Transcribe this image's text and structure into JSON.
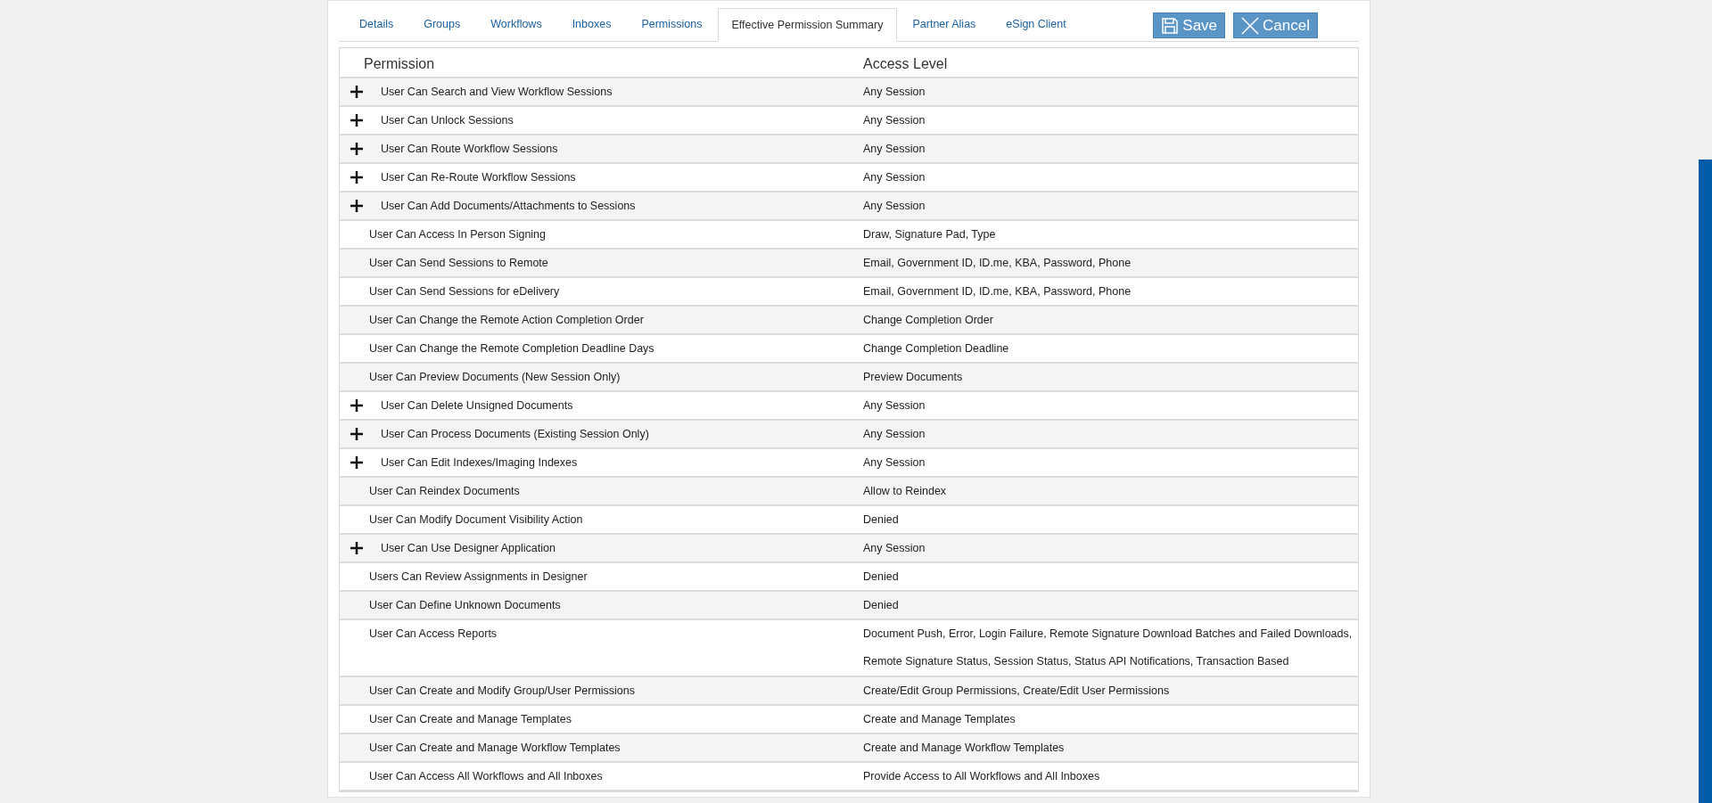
{
  "tabs": [
    {
      "label": "Details",
      "selected": false
    },
    {
      "label": "Groups",
      "selected": false
    },
    {
      "label": "Workflows",
      "selected": false
    },
    {
      "label": "Inboxes",
      "selected": false
    },
    {
      "label": "Permissions",
      "selected": false
    },
    {
      "label": "Effective Permission Summary",
      "selected": true
    },
    {
      "label": "Partner Alias",
      "selected": false
    },
    {
      "label": "eSign Client",
      "selected": false
    }
  ],
  "buttons": [
    {
      "kind": "save",
      "label": "Save"
    },
    {
      "kind": "cancel",
      "label": "Cancel"
    }
  ],
  "table": {
    "columns": [
      "Permission",
      "Access Level"
    ],
    "rows": [
      {
        "kind": "expandable",
        "expanded": false,
        "permission": "User Can Search and View Workflow Sessions",
        "access": [
          "Any Session"
        ]
      },
      {
        "kind": "expandable",
        "expanded": false,
        "permission": "User Can Unlock Sessions",
        "access": [
          "Any Session"
        ]
      },
      {
        "kind": "expandable",
        "expanded": false,
        "permission": "User Can Route Workflow Sessions",
        "access": [
          "Any Session"
        ]
      },
      {
        "kind": "expandable",
        "expanded": false,
        "permission": "User Can Re-Route Workflow Sessions",
        "access": [
          "Any Session"
        ]
      },
      {
        "kind": "expandable",
        "expanded": false,
        "permission": "User Can Add Documents/Attachments to Sessions",
        "access": [
          "Any Session"
        ]
      },
      {
        "kind": "plain",
        "permission": "User Can Access In Person Signing",
        "access": [
          "Draw, Signature Pad, Type"
        ]
      },
      {
        "kind": "plain",
        "permission": "User Can Send Sessions to Remote",
        "access": [
          "Email, Government ID, ID.me, KBA, Password, Phone"
        ]
      },
      {
        "kind": "plain",
        "permission": "User Can Send Sessions for eDelivery",
        "access": [
          "Email, Government ID, ID.me, KBA, Password, Phone"
        ]
      },
      {
        "kind": "plain",
        "permission": "User Can Change the Remote Action Completion Order",
        "access": [
          "Change Completion Order"
        ]
      },
      {
        "kind": "plain",
        "permission": "User Can Change the Remote Completion Deadline Days",
        "access": [
          "Change Completion Deadline"
        ]
      },
      {
        "kind": "plain",
        "permission": "User Can Preview Documents (New Session Only)",
        "access": [
          "Preview Documents"
        ]
      },
      {
        "kind": "expandable",
        "expanded": false,
        "permission": "User Can Delete Unsigned Documents",
        "access": [
          "Any Session"
        ]
      },
      {
        "kind": "expandable",
        "expanded": false,
        "permission": "User Can Process Documents (Existing Session Only)",
        "access": [
          "Any Session"
        ]
      },
      {
        "kind": "expandable",
        "expanded": false,
        "permission": "User Can Edit Indexes/Imaging Indexes",
        "access": [
          "Any Session"
        ]
      },
      {
        "kind": "plain",
        "permission": "User Can Reindex Documents",
        "access": [
          "Allow to Reindex"
        ]
      },
      {
        "kind": "plain",
        "permission": "User Can Modify Document Visibility Action",
        "access": [
          "Denied"
        ]
      },
      {
        "kind": "expandable",
        "expanded": false,
        "permission": "User Can Use Designer Application",
        "access": [
          "Any Session"
        ]
      },
      {
        "kind": "plain",
        "permission": "Users Can Review Assignments in Designer",
        "access": [
          "Denied"
        ]
      },
      {
        "kind": "plain",
        "permission": "User Can Define Unknown Documents",
        "access": [
          "Denied"
        ]
      },
      {
        "kind": "plain",
        "permission": "User Can Access Reports",
        "access": [
          "Document Push, Error, Login Failure, Remote Signature Download Batches and Failed Downloads,",
          "Remote Signature Status, Session Status, Status API Notifications, Transaction Based"
        ]
      },
      {
        "kind": "plain",
        "permission": "User Can Create and Modify Group/User Permissions",
        "access": [
          "Create/Edit Group Permissions, Create/Edit User Permissions"
        ]
      },
      {
        "kind": "plain",
        "permission": "User Can Create and Manage Templates",
        "access": [
          "Create and Manage Templates"
        ]
      },
      {
        "kind": "plain",
        "permission": "User Can Create and Manage Workflow Templates",
        "access": [
          "Create and Manage Workflow Templates"
        ]
      },
      {
        "kind": "plain",
        "permission": "User Can Access All Workflows and All Inboxes",
        "access": [
          "Provide Access to All Workflows and All Inboxes"
        ]
      }
    ]
  }
}
